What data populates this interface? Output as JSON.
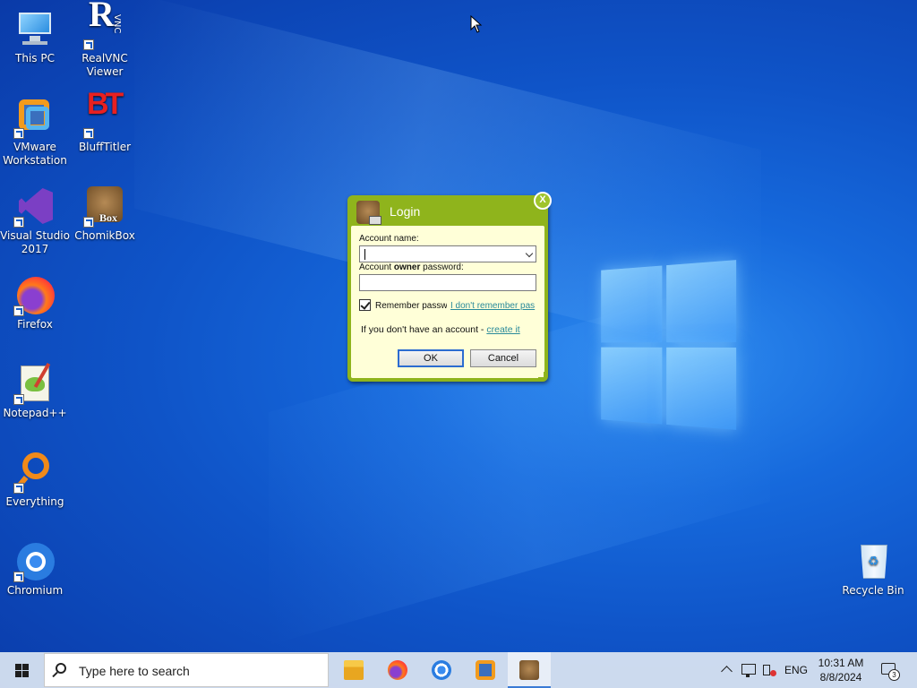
{
  "desktop": {
    "icons": [
      {
        "label": "This PC"
      },
      {
        "label": "RealVNC Viewer"
      },
      {
        "label": "VMware Workstation"
      },
      {
        "label": "BluffTitler"
      },
      {
        "label": "Visual Studio 2017"
      },
      {
        "label": "ChomikBox"
      },
      {
        "label": "Firefox"
      },
      {
        "label": "Notepad++"
      },
      {
        "label": "Everything"
      },
      {
        "label": "Chromium"
      },
      {
        "label": "Recycle Bin"
      }
    ]
  },
  "login_dialog": {
    "title": "Login",
    "close_label": "X",
    "account_label": "Account name:",
    "account_value": "",
    "password_label_pre": "Account",
    "password_label_bold": "owner",
    "password_label_post": "password:",
    "password_value": "",
    "remember_label": "Remember passw",
    "remember_checked": true,
    "forgot_link": "I don't remember pas",
    "no_account_text": "If you don't have an account -",
    "create_link": "create it",
    "ok_label": "OK",
    "cancel_label": "Cancel",
    "bg_color": "#8fb41c",
    "body_color": "#ffffd8"
  },
  "taskbar": {
    "search_placeholder": "Type here to search",
    "apps": [
      {
        "name": "file-explorer-icon"
      },
      {
        "name": "firefox-icon"
      },
      {
        "name": "chromium-icon"
      },
      {
        "name": "vmware-icon"
      },
      {
        "name": "chomikbox-icon",
        "active": true
      }
    ],
    "tray": {
      "language": "ENG",
      "time": "10:31 AM",
      "date": "8/8/2024",
      "notification_count": "3"
    }
  }
}
